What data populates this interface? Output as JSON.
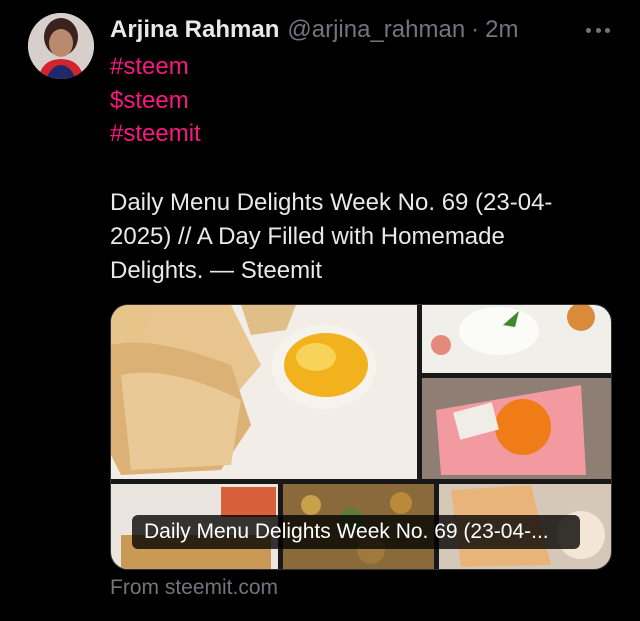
{
  "tweet": {
    "author_name": "Arjina Rahman",
    "author_handle": "@arjina_rahman",
    "separator": "·",
    "time": "2m",
    "hashtags": [
      "#steem",
      "$steem",
      "#steemit"
    ],
    "text": "Daily Menu Delights Week No. 69 (23-04-2025) // A Day Filled with Homemade Delights. — Steemit"
  },
  "card": {
    "title": "Daily Menu Delights Week No. 69 (23-04-...",
    "source": "From steemit.com"
  },
  "icons": [
    "more-options-icon"
  ],
  "colors": {
    "background": "#000000",
    "hashtag": "#f91880",
    "muted": "#71767b",
    "text": "#e7e9ea"
  }
}
